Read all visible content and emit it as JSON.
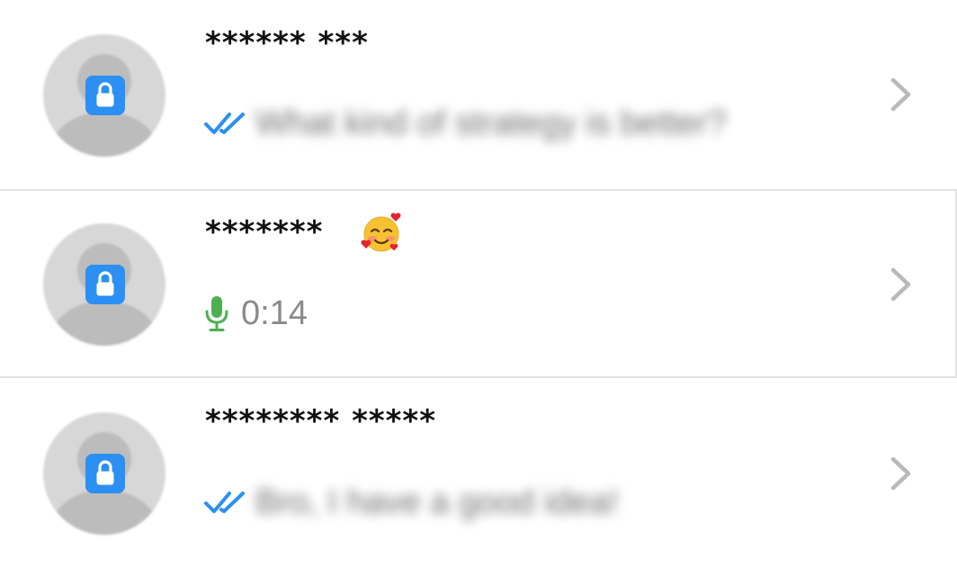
{
  "chats": [
    {
      "name": "****** ***",
      "has_emoji": false,
      "emoji_icon": "",
      "preview_type": "text",
      "status_icon": "double-check-icon",
      "preview_text": "What kind of strategy is better?",
      "preview_blurred": true
    },
    {
      "name": "*******",
      "has_emoji": true,
      "emoji_icon": "smiling-face-with-hearts-icon",
      "preview_type": "voice",
      "status_icon": "microphone-icon",
      "preview_text": "0:14",
      "preview_blurred": false
    },
    {
      "name": "******** *****",
      "has_emoji": false,
      "emoji_icon": "",
      "preview_type": "text",
      "status_icon": "double-check-icon",
      "preview_text": "Bro, I have a good idea!",
      "preview_blurred": true
    }
  ],
  "colors": {
    "tick_blue": "#2b8ff3",
    "lock_badge": "#2b8ff3",
    "mic_green": "#4cb050",
    "chevron_gray": "#b8b8bd",
    "name_text": "#111111",
    "duration_text": "#8a8a8a"
  }
}
